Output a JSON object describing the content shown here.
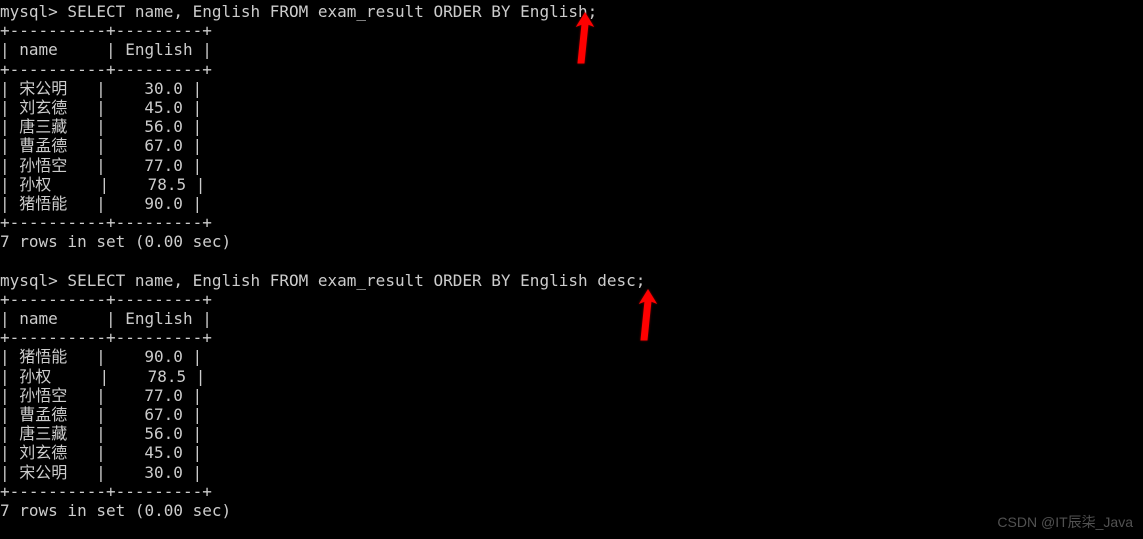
{
  "prompt": "mysql>",
  "query1": {
    "sql": " SELECT name, English FROM exam_result ORDER BY English;",
    "border": "+----------+---------+",
    "header_name": "name",
    "header_english": "English",
    "rows": [
      {
        "name": "宋公明",
        "english": "30.0"
      },
      {
        "name": "刘玄德",
        "english": "45.0"
      },
      {
        "name": "唐三藏",
        "english": "56.0"
      },
      {
        "name": "曹孟德",
        "english": "67.0"
      },
      {
        "name": "孙悟空",
        "english": "77.0"
      },
      {
        "name": "孙权",
        "english": "78.5"
      },
      {
        "name": "猪悟能",
        "english": "90.0"
      }
    ],
    "footer": "7 rows in set (0.00 sec)"
  },
  "query2": {
    "sql": " SELECT name, English FROM exam_result ORDER BY English desc;",
    "border": "+----------+---------+",
    "header_name": "name",
    "header_english": "English",
    "rows": [
      {
        "name": "猪悟能",
        "english": "90.0"
      },
      {
        "name": "孙权",
        "english": "78.5"
      },
      {
        "name": "孙悟空",
        "english": "77.0"
      },
      {
        "name": "曹孟德",
        "english": "67.0"
      },
      {
        "name": "唐三藏",
        "english": "56.0"
      },
      {
        "name": "刘玄德",
        "english": "45.0"
      },
      {
        "name": "宋公明",
        "english": "30.0"
      }
    ],
    "footer": "7 rows in set (0.00 sec)"
  },
  "watermark": "CSDN @IT辰柒_Java"
}
